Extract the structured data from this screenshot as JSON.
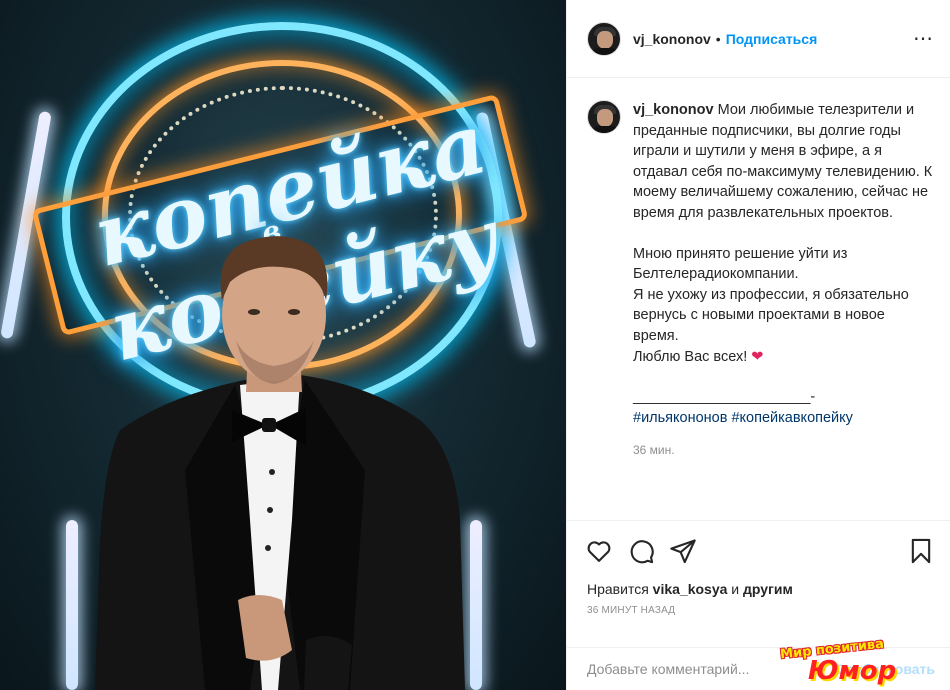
{
  "photo": {
    "logo_line1": "копейка",
    "logo_line2": "в",
    "logo_line3": "копейку"
  },
  "header": {
    "username": "vj_kononov",
    "separator": "•",
    "follow_label": "Подписаться",
    "more_icon": "more-horizontal-icon"
  },
  "caption": {
    "username": "vj_kononov",
    "paragraph1": "Мои любимые телезрители и преданные подписчики, вы долгие годы играли и шутили у меня в эфире, а я отдавал себя по-максимуму телевидению. К моему величайшему сожалению, сейчас не время для развлекательных проектов.",
    "paragraph2": "Мною принято решение уйти из Белтелерадиокомпании.\nЯ не ухожу из профессии, я обязательно вернусь с новыми проектами в новое время.\nЛюблю Вас всех!",
    "heart_emoji": "❤",
    "divider": "______________________-",
    "hashtags": "#ильякононов #копейкавкопейку",
    "time": "36 мин."
  },
  "actions": {
    "icons": [
      "heart-icon",
      "comment-icon",
      "share-icon",
      "bookmark-icon"
    ]
  },
  "likes": {
    "prefix": "Нравится",
    "user": "vika_kosya",
    "middle": "и",
    "others": "другим"
  },
  "post_time": "36 минут назад",
  "comment": {
    "placeholder": "Добавьте комментарий...",
    "publish_label": "Опубликовать"
  },
  "watermark": {
    "top": "Мир позитива",
    "bottom": "Юмор"
  },
  "colors": {
    "link_blue": "#0095f6",
    "hashtag": "#00376b",
    "secondary": "#8e8e8e"
  }
}
